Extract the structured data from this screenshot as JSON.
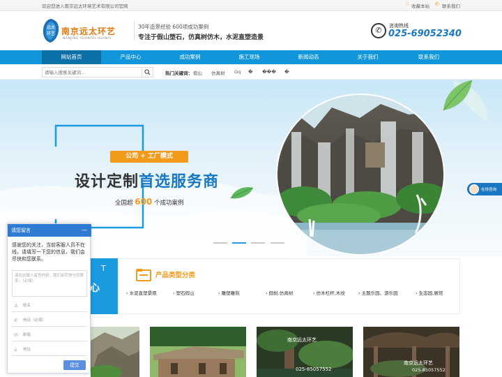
{
  "topbar": {
    "welcome": "欢迎您进入南京远太环境艺术有限公司官网",
    "bookmark": "收藏本站",
    "contact": "联系我们"
  },
  "header": {
    "logo_cn": "南京远太环艺",
    "logo_pinyin": "NANJING YUANTAI HUANYI",
    "logo_badge": "远太环艺",
    "tagline_top": "30年造景经验 600项成功案例",
    "tagline_main": "专注于假山塑石，仿真树仿木，水泥直塑造景",
    "hotline_label": "咨询热线",
    "hotline_number": "025-69052340"
  },
  "nav": [
    {
      "label": "网站首页",
      "active": true
    },
    {
      "label": "产品中心"
    },
    {
      "label": "成功案例"
    },
    {
      "label": "施工现场"
    },
    {
      "label": "新闻动态"
    },
    {
      "label": "关于我们"
    },
    {
      "label": "联系我们"
    }
  ],
  "search": {
    "placeholder": "请输入搜索关键词...",
    "hot_label": "热门关键词：",
    "hot": [
      "假山",
      "仿真树",
      "Gq",
      "�",
      "���",
      "�"
    ]
  },
  "banner": {
    "badge": "公司 + 工厂模式",
    "headline_1": "设计定制",
    "headline_2": "首选服务商",
    "sub_prefix": "全国超",
    "sub_number": "600",
    "sub_suffix": "个成功案例",
    "slider_dots": 4,
    "active_dot": 1
  },
  "side_service": {
    "label": "在线咨询"
  },
  "products": {
    "title": "产品类型分类",
    "left_partial_1": "T",
    "left_partial_2": "心",
    "categories": [
      "水泥直塑景观",
      "塑石假山",
      "雕塑雕刻",
      "假树,仿真树",
      "仿木栏杆,木纹",
      "主题乐园、游乐园",
      "生态园,展馆"
    ]
  },
  "thumbs": [
    {
      "caption": ""
    },
    {
      "caption": ""
    },
    {
      "caption": "南京远太环艺",
      "phone": "025-85057552"
    },
    {
      "caption": "南京远太环艺",
      "phone": "025-85057552"
    }
  ],
  "chat": {
    "title": "请您留言",
    "minimize": "—",
    "intro": "感谢您的关注，当前客服人员不在线，请填写一下您的信息，我们会尽快和您联系。",
    "textarea_placeholder": "请在此输入留言内容，我们会尽快与您联系。（必填）",
    "name_placeholder": "姓名",
    "phone_placeholder": "电话（必填）",
    "email_placeholder": "邮箱",
    "address_placeholder": "地址",
    "submit": "提交"
  },
  "colors": {
    "brand": "#1296db",
    "nav_active": "#0b6fa8",
    "accent_orange": "#f29a1b",
    "hotline": "#1a78c2",
    "chat_header": "#2f7bd4"
  }
}
